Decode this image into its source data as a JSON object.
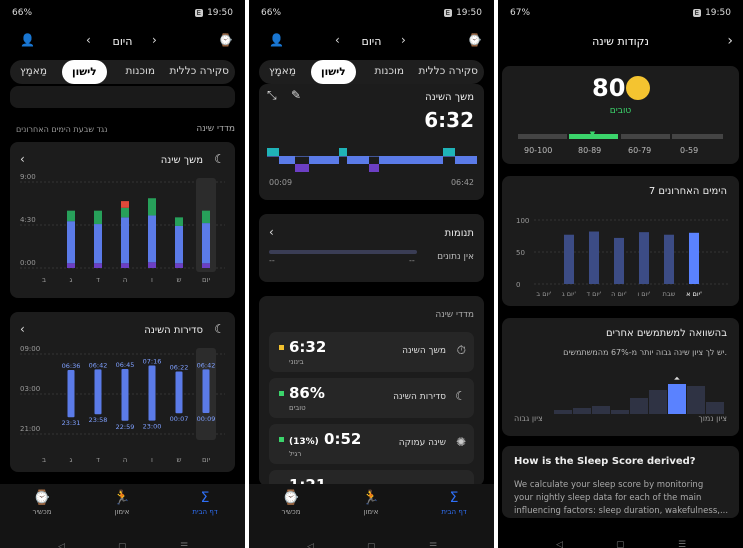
{
  "s1": {
    "status": {
      "battery": "66%",
      "time": "19:50",
      "badge": "E"
    },
    "header": {
      "title": "היום"
    },
    "tabs": [
      "סקירה כללית",
      "מוכנות",
      "לישון",
      "מַאמָץ"
    ],
    "section": {
      "right": "מדדי שינה",
      "left": "נגד שבעת הימים האחרונים"
    },
    "duration_card": {
      "title": "משך שינה"
    },
    "consistency_card": {
      "title": "סדירות השינה"
    },
    "nav": [
      "דף הבית",
      "אימון",
      "מכשיר"
    ]
  },
  "s2": {
    "status": {
      "battery": "66%",
      "time": "19:50",
      "badge": "E"
    },
    "header": {
      "title": "היום"
    },
    "tabs": [
      "סקירה כללית",
      "מוכנות",
      "לישון",
      "מַאמָץ"
    ],
    "duration": {
      "title": "משך השינה",
      "value": "6:32",
      "start": "00:09",
      "end": "06:42"
    },
    "naps": {
      "title": "תנומות",
      "empty": "אין נתונים",
      "dash_l": "--",
      "dash_r": "--"
    },
    "metrics_title": "מדדי שינה",
    "metrics": [
      {
        "name": "משך השינה",
        "value": "6:32",
        "sub": "בינוני",
        "color": "#f2c12e"
      },
      {
        "name": "סדירות השינה",
        "value": "86%",
        "sub": "טובים",
        "color": "#3bd46b"
      },
      {
        "name": "שינה עמוקה",
        "value": "0:52",
        "pct": "(13%)",
        "sub": "רגיל",
        "color": "#3bd46b"
      },
      {
        "name": "",
        "value": "1:21",
        "sub": "",
        "color": "#3bd46b"
      }
    ],
    "nav": [
      "דף הבית",
      "אימון",
      "מכשיר"
    ]
  },
  "s3": {
    "status": {
      "battery": "67%",
      "time": "19:50",
      "badge": "E"
    },
    "header": {
      "title": "נקודות שינה"
    },
    "score": {
      "value": "80",
      "label": "טובים"
    },
    "ranges": [
      "90-100",
      "80-89",
      "60-79",
      "0-59"
    ],
    "last7": {
      "title": "7 הימים האחרונים"
    },
    "compare": {
      "title": "בהשוואה למשתמשים אחרים",
      "text": "יש לך ציון שינה גבוה יותר מ-67% מהמשתמשים.",
      "high": "ציון גבוה",
      "low": "ציון נמוך"
    },
    "derived": {
      "title": "How is the Sleep Score derived?",
      "text1": "We calculate your sleep score by monitoring",
      "text2": "your nightly sleep data for each of the main",
      "text3": "influencing factors: sleep duration, wakefulness,..."
    }
  },
  "chart_data": [
    {
      "type": "bar",
      "title": "משך שינה",
      "categories": [
        "ב",
        "ג",
        "ד",
        "ה",
        "ו",
        "ש",
        "יום"
      ],
      "yticks": [
        "9:00",
        "4:30",
        "0:00"
      ],
      "series": [
        {
          "values": [
            0,
            0.5,
            0.5,
            0.5,
            0.6,
            0.5,
            0.5
          ]
        },
        {
          "values": [
            0,
            4.4,
            4.1,
            4.8,
            4.9,
            3.9,
            4.2
          ]
        },
        {
          "values": [
            0,
            1.1,
            1.4,
            1.0,
            1.8,
            0.9,
            1.3
          ]
        },
        {
          "values": [
            0,
            0,
            0,
            0.7,
            0,
            0,
            0
          ]
        }
      ]
    },
    {
      "type": "bar",
      "title": "סדירות השינה",
      "categories": [
        "ב",
        "ג",
        "ד",
        "ה",
        "ו",
        "ש",
        "יום"
      ],
      "yticks": [
        "09:00",
        "03:00",
        "21:00"
      ],
      "bedtimes": [
        "",
        "23:31",
        "23:58",
        "22:59",
        "23:00",
        "00:07",
        "00:09"
      ],
      "waketimes": [
        "",
        "06:36",
        "06:42",
        "06:45",
        "07:16",
        "06:22",
        "06:42"
      ]
    },
    {
      "type": "bar",
      "title": "7 הימים האחרונים",
      "categories": [
        "יום ב'",
        "יום ג'",
        "יום ד'",
        "יום ה'",
        "יום ו'",
        "שבת",
        "יום א'"
      ],
      "values": [
        0,
        77,
        82,
        72,
        81,
        77,
        80
      ],
      "yticks": [
        "100",
        "50",
        "0"
      ],
      "ylim": [
        0,
        100
      ]
    }
  ]
}
